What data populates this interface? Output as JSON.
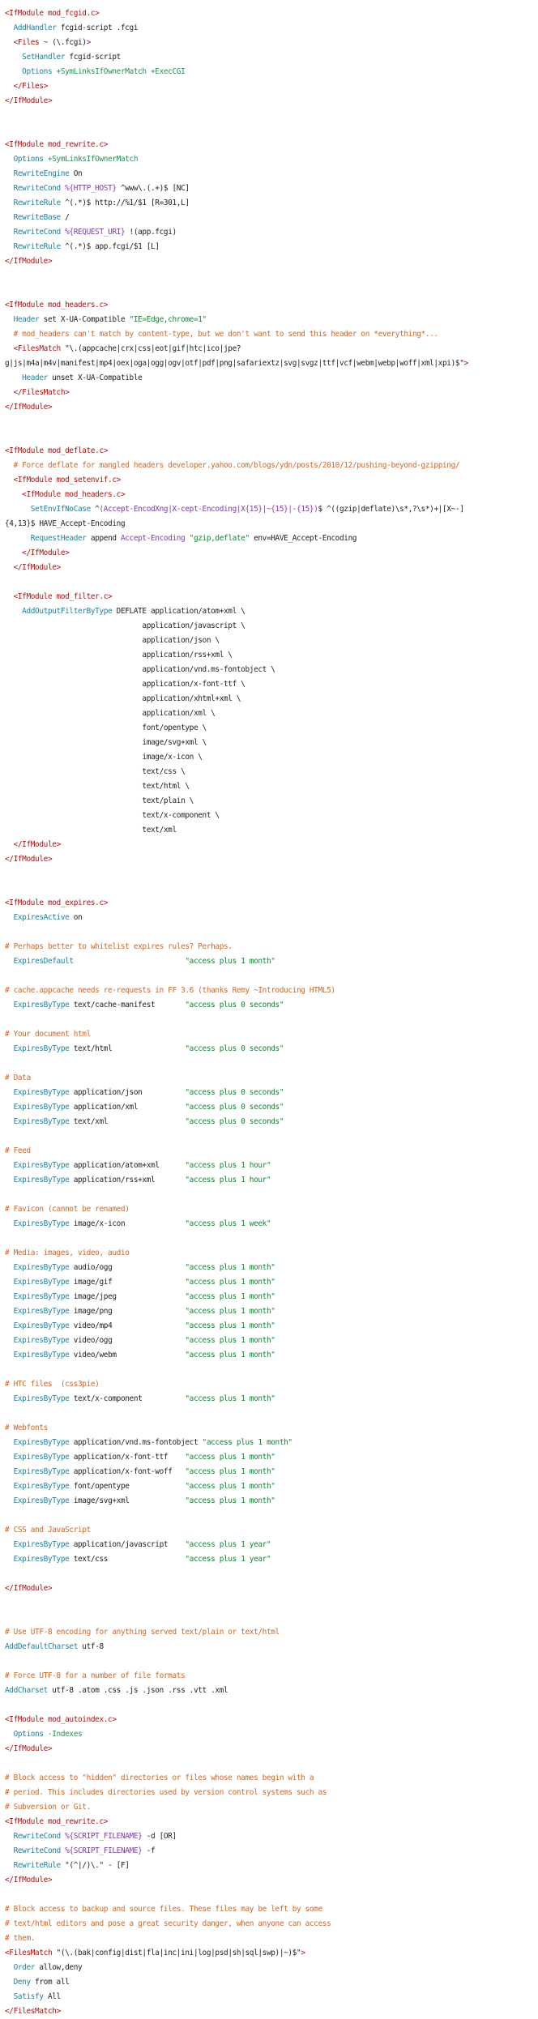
{
  "colors": {
    "background": "#ffffff",
    "directive_tag": "#a31515",
    "keyword": "#267f99",
    "comment": "#c8692e",
    "string": "#1a7f37",
    "variable": "#7b3fa0",
    "plain": "#222222"
  },
  "lines": [
    [
      [
        "d",
        "<IfModule mod_fcgid.c>"
      ]
    ],
    [
      [
        "k",
        "  AddHandler"
      ],
      [
        "p",
        " fcgid-script .fcgi"
      ]
    ],
    [
      [
        "d",
        "  <Files"
      ],
      [
        "p",
        " ~ (\\.fcgi)"
      ],
      [
        "d",
        ">"
      ]
    ],
    [
      [
        "k",
        "    SetHandler"
      ],
      [
        "p",
        " fcgid-script"
      ]
    ],
    [
      [
        "k",
        "    Options"
      ],
      [
        "o",
        " +SymLinksIfOwnerMatch +ExecCGI"
      ]
    ],
    [
      [
        "d",
        "  </Files>"
      ]
    ],
    [
      [
        "d",
        "</IfModule>"
      ]
    ],
    [],
    [],
    [
      [
        "d",
        "<IfModule mod_rewrite.c>"
      ]
    ],
    [
      [
        "k",
        "  Options"
      ],
      [
        "o",
        " +SymLinksIfOwnerMatch"
      ]
    ],
    [
      [
        "k",
        "  RewriteEngine"
      ],
      [
        "p",
        " On"
      ]
    ],
    [
      [
        "k",
        "  RewriteCond"
      ],
      [
        "r",
        " %{HTTP_HOST}"
      ],
      [
        "p",
        " ^www\\.(.+)$ [NC]"
      ]
    ],
    [
      [
        "k",
        "  RewriteRule"
      ],
      [
        "p",
        " ^(.*)$ http://%1/$1 [R=301,L]"
      ]
    ],
    [
      [
        "k",
        "  RewriteBase"
      ],
      [
        "p",
        " /"
      ]
    ],
    [
      [
        "k",
        "  RewriteCond"
      ],
      [
        "r",
        " %{REQUEST_URI}"
      ],
      [
        "p",
        " !(app.fcgi)"
      ]
    ],
    [
      [
        "k",
        "  RewriteRule"
      ],
      [
        "p",
        " ^(.*)$ app.fcgi/$1 [L]"
      ]
    ],
    [
      [
        "d",
        "</IfModule>"
      ]
    ],
    [],
    [],
    [
      [
        "d",
        "<IfModule mod_headers.c>"
      ]
    ],
    [
      [
        "k",
        "  Header"
      ],
      [
        "p",
        " set X-UA-Compatible "
      ],
      [
        "s",
        "\"IE=Edge,chrome=1\""
      ]
    ],
    [
      [
        "c",
        "  # mod_headers can't match by content-type, but we don't want to send this header on *everything*..."
      ]
    ],
    [
      [
        "d",
        "  <FilesMatch"
      ],
      [
        "p",
        " \"\\.(appcache|crx|css|eot|gif|htc|ico|jpe?"
      ]
    ],
    [
      [
        "p",
        "g|js|m4a|m4v|manifest|mp4|oex|oga|ogg|ogv|otf|pdf|png|safariextz|svg|svgz|ttf|vcf|webm|webp|woff|xml|xpi)$\""
      ],
      [
        "d",
        ">"
      ]
    ],
    [
      [
        "k",
        "    Header"
      ],
      [
        "p",
        " unset X-UA-Compatible"
      ]
    ],
    [
      [
        "d",
        "  </FilesMatch>"
      ]
    ],
    [
      [
        "d",
        "</IfModule>"
      ]
    ],
    [],
    [],
    [
      [
        "d",
        "<IfModule mod_deflate.c>"
      ]
    ],
    [
      [
        "c",
        "  # Force deflate for mangled headers developer.yahoo.com/blogs/ydn/posts/2010/12/pushing-beyond-gzipping/"
      ]
    ],
    [
      [
        "d",
        "  <IfModule mod_setenvif.c>"
      ]
    ],
    [
      [
        "d",
        "    <IfModule mod_headers.c>"
      ]
    ],
    [
      [
        "k",
        "      SetEnvIfNoCase"
      ],
      [
        "p",
        " ^"
      ],
      [
        "r",
        "(Accept-EncodXng|X-cept-Encoding|X{15}|~{15}|-{15})"
      ],
      [
        "p",
        "$ ^((gzip|deflate)\\s*,?\\s*)+|[X~-]"
      ]
    ],
    [
      [
        "p",
        "{4,13}$ HAVE_Accept-Encoding"
      ]
    ],
    [
      [
        "k",
        "      RequestHeader"
      ],
      [
        "p",
        " append "
      ],
      [
        "r",
        "Accept-Encoding"
      ],
      [
        "s",
        " \"gzip,deflate\""
      ],
      [
        "p",
        " env=HAVE_Accept-Encoding"
      ]
    ],
    [
      [
        "d",
        "    </IfModule>"
      ]
    ],
    [
      [
        "d",
        "  </IfModule>"
      ]
    ],
    [],
    [
      [
        "d",
        "  <IfModule mod_filter.c>"
      ]
    ],
    [
      [
        "k",
        "    AddOutputFilterByType"
      ],
      [
        "p",
        " DEFLATE application/atom+xml \\"
      ]
    ],
    [
      [
        "p",
        "                                application/javascript \\"
      ]
    ],
    [
      [
        "p",
        "                                application/json \\"
      ]
    ],
    [
      [
        "p",
        "                                application/rss+xml \\"
      ]
    ],
    [
      [
        "p",
        "                                application/vnd.ms-fontobject \\"
      ]
    ],
    [
      [
        "p",
        "                                application/x-font-ttf \\"
      ]
    ],
    [
      [
        "p",
        "                                application/xhtml+xml \\"
      ]
    ],
    [
      [
        "p",
        "                                application/xml \\"
      ]
    ],
    [
      [
        "p",
        "                                font/opentype \\"
      ]
    ],
    [
      [
        "p",
        "                                image/svg+xml \\"
      ]
    ],
    [
      [
        "p",
        "                                image/x-icon \\"
      ]
    ],
    [
      [
        "p",
        "                                text/css \\"
      ]
    ],
    [
      [
        "p",
        "                                text/html \\"
      ]
    ],
    [
      [
        "p",
        "                                text/plain \\"
      ]
    ],
    [
      [
        "p",
        "                                text/x-component \\"
      ]
    ],
    [
      [
        "p",
        "                                text/xml"
      ]
    ],
    [
      [
        "d",
        "  </IfModule>"
      ]
    ],
    [
      [
        "d",
        "</IfModule>"
      ]
    ],
    [],
    [],
    [
      [
        "d",
        "<IfModule mod_expires.c>"
      ]
    ],
    [
      [
        "k",
        "  ExpiresActive"
      ],
      [
        "p",
        " on"
      ]
    ],
    [],
    [
      [
        "c",
        "# Perhaps better to whitelist expires rules? Perhaps."
      ]
    ],
    [
      [
        "k",
        "  ExpiresDefault"
      ],
      [
        "s",
        "                          \"access plus 1 month\""
      ]
    ],
    [],
    [
      [
        "c",
        "# cache.appcache needs re-requests in FF 3.6 (thanks Remy ~Introducing HTML5)"
      ]
    ],
    [
      [
        "k",
        "  ExpiresByType"
      ],
      [
        "p",
        " text/cache-manifest       "
      ],
      [
        "s",
        "\"access plus 0 seconds\""
      ]
    ],
    [],
    [
      [
        "c",
        "# Your document html"
      ]
    ],
    [
      [
        "k",
        "  ExpiresByType"
      ],
      [
        "p",
        " text/html                 "
      ],
      [
        "s",
        "\"access plus 0 seconds\""
      ]
    ],
    [],
    [
      [
        "c",
        "# Data"
      ]
    ],
    [
      [
        "k",
        "  ExpiresByType"
      ],
      [
        "p",
        " application/json          "
      ],
      [
        "s",
        "\"access plus 0 seconds\""
      ]
    ],
    [
      [
        "k",
        "  ExpiresByType"
      ],
      [
        "p",
        " application/xml           "
      ],
      [
        "s",
        "\"access plus 0 seconds\""
      ]
    ],
    [
      [
        "k",
        "  ExpiresByType"
      ],
      [
        "p",
        " text/xml                  "
      ],
      [
        "s",
        "\"access plus 0 seconds\""
      ]
    ],
    [],
    [
      [
        "c",
        "# Feed"
      ]
    ],
    [
      [
        "k",
        "  ExpiresByType"
      ],
      [
        "p",
        " application/atom+xml      "
      ],
      [
        "s",
        "\"access plus 1 hour\""
      ]
    ],
    [
      [
        "k",
        "  ExpiresByType"
      ],
      [
        "p",
        " application/rss+xml       "
      ],
      [
        "s",
        "\"access plus 1 hour\""
      ]
    ],
    [],
    [
      [
        "c",
        "# Favicon (cannot be renamed)"
      ]
    ],
    [
      [
        "k",
        "  ExpiresByType"
      ],
      [
        "p",
        " image/x-icon              "
      ],
      [
        "s",
        "\"access plus 1 week\""
      ]
    ],
    [],
    [
      [
        "c",
        "# Media: images, video, audio"
      ]
    ],
    [
      [
        "k",
        "  ExpiresByType"
      ],
      [
        "p",
        " audio/ogg                 "
      ],
      [
        "s",
        "\"access plus 1 month\""
      ]
    ],
    [
      [
        "k",
        "  ExpiresByType"
      ],
      [
        "p",
        " image/gif                 "
      ],
      [
        "s",
        "\"access plus 1 month\""
      ]
    ],
    [
      [
        "k",
        "  ExpiresByType"
      ],
      [
        "p",
        " image/jpeg                "
      ],
      [
        "s",
        "\"access plus 1 month\""
      ]
    ],
    [
      [
        "k",
        "  ExpiresByType"
      ],
      [
        "p",
        " image/png                 "
      ],
      [
        "s",
        "\"access plus 1 month\""
      ]
    ],
    [
      [
        "k",
        "  ExpiresByType"
      ],
      [
        "p",
        " video/mp4                 "
      ],
      [
        "s",
        "\"access plus 1 month\""
      ]
    ],
    [
      [
        "k",
        "  ExpiresByType"
      ],
      [
        "p",
        " video/ogg                 "
      ],
      [
        "s",
        "\"access plus 1 month\""
      ]
    ],
    [
      [
        "k",
        "  ExpiresByType"
      ],
      [
        "p",
        " video/webm                "
      ],
      [
        "s",
        "\"access plus 1 month\""
      ]
    ],
    [],
    [
      [
        "c",
        "# HTC files  (css3pie)"
      ]
    ],
    [
      [
        "k",
        "  ExpiresByType"
      ],
      [
        "p",
        " text/x-component          "
      ],
      [
        "s",
        "\"access plus 1 month\""
      ]
    ],
    [],
    [
      [
        "c",
        "# Webfonts"
      ]
    ],
    [
      [
        "k",
        "  ExpiresByType"
      ],
      [
        "p",
        " application/vnd.ms-fontobject "
      ],
      [
        "s",
        "\"access plus 1 month\""
      ]
    ],
    [
      [
        "k",
        "  ExpiresByType"
      ],
      [
        "p",
        " application/x-font-ttf    "
      ],
      [
        "s",
        "\"access plus 1 month\""
      ]
    ],
    [
      [
        "k",
        "  ExpiresByType"
      ],
      [
        "p",
        " application/x-font-woff   "
      ],
      [
        "s",
        "\"access plus 1 month\""
      ]
    ],
    [
      [
        "k",
        "  ExpiresByType"
      ],
      [
        "p",
        " font/opentype             "
      ],
      [
        "s",
        "\"access plus 1 month\""
      ]
    ],
    [
      [
        "k",
        "  ExpiresByType"
      ],
      [
        "p",
        " image/svg+xml             "
      ],
      [
        "s",
        "\"access plus 1 month\""
      ]
    ],
    [],
    [
      [
        "c",
        "# CSS and JavaScript"
      ]
    ],
    [
      [
        "k",
        "  ExpiresByType"
      ],
      [
        "p",
        " application/javascript    "
      ],
      [
        "s",
        "\"access plus 1 year\""
      ]
    ],
    [
      [
        "k",
        "  ExpiresByType"
      ],
      [
        "p",
        " text/css                  "
      ],
      [
        "s",
        "\"access plus 1 year\""
      ]
    ],
    [],
    [
      [
        "d",
        "</IfModule>"
      ]
    ],
    [],
    [],
    [
      [
        "c",
        "# Use UTF-8 encoding for anything served text/plain or text/html"
      ]
    ],
    [
      [
        "k",
        "AddDefaultCharset"
      ],
      [
        "p",
        " utf-8"
      ]
    ],
    [],
    [
      [
        "c",
        "# Force UTF-8 for a number of file formats"
      ]
    ],
    [
      [
        "k",
        "AddCharset"
      ],
      [
        "p",
        " utf-8 .atom .css .js .json .rss .vtt .xml"
      ]
    ],
    [],
    [
      [
        "d",
        "<IfModule mod_autoindex.c>"
      ]
    ],
    [
      [
        "k",
        "  Options"
      ],
      [
        "o",
        " -Indexes"
      ]
    ],
    [
      [
        "d",
        "</IfModule>"
      ]
    ],
    [],
    [
      [
        "c",
        "# Block access to \"hidden\" directories or files whose names begin with a"
      ]
    ],
    [
      [
        "c",
        "# period. This includes directories used by version control systems such as"
      ]
    ],
    [
      [
        "c",
        "# Subversion or Git."
      ]
    ],
    [
      [
        "d",
        "<IfModule mod_rewrite.c>"
      ]
    ],
    [
      [
        "k",
        "  RewriteCond"
      ],
      [
        "r",
        " %{SCRIPT_FILENAME}"
      ],
      [
        "p",
        " -d [OR]"
      ]
    ],
    [
      [
        "k",
        "  RewriteCond"
      ],
      [
        "r",
        " %{SCRIPT_FILENAME}"
      ],
      [
        "p",
        " -f"
      ]
    ],
    [
      [
        "k",
        "  RewriteRule"
      ],
      [
        "p",
        " \"(^|/)\\.\" - [F]"
      ]
    ],
    [
      [
        "d",
        "</IfModule>"
      ]
    ],
    [],
    [
      [
        "c",
        "# Block access to backup and source files. These files may be left by some"
      ]
    ],
    [
      [
        "c",
        "# text/html editors and pose a great security danger, when anyone can access"
      ]
    ],
    [
      [
        "c",
        "# them."
      ]
    ],
    [
      [
        "d",
        "<FilesMatch"
      ],
      [
        "p",
        " \"(\\.(bak|config|dist|fla|inc|ini|log|psd|sh|sql|swp)|~)$\""
      ],
      [
        "d",
        ">"
      ]
    ],
    [
      [
        "k",
        "  Order"
      ],
      [
        "p",
        " allow,deny"
      ]
    ],
    [
      [
        "k",
        "  Deny"
      ],
      [
        "p",
        " from all"
      ]
    ],
    [
      [
        "k",
        "  Satisfy"
      ],
      [
        "p",
        " All"
      ]
    ],
    [
      [
        "d",
        "</FilesMatch>"
      ]
    ]
  ]
}
